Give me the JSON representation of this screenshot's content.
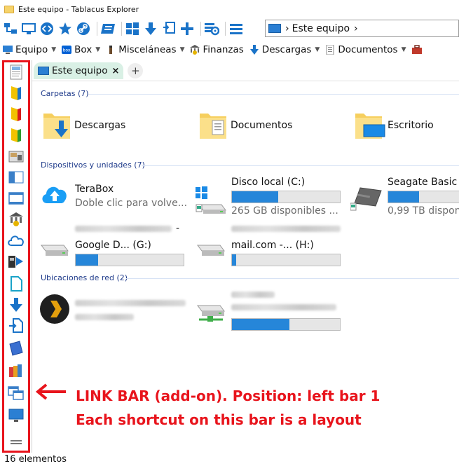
{
  "window": {
    "title": "Este equipo - Tablacus Explorer"
  },
  "address": {
    "separator": "›",
    "location": "Este equipo",
    "chevron": "›"
  },
  "favorites": [
    {
      "label": "Equipo",
      "icon": "monitor-icon"
    },
    {
      "label": "Box",
      "icon": "box-icon"
    },
    {
      "label": "Misceláneas",
      "icon": "pencil-icon"
    },
    {
      "label": "Finanzas",
      "icon": "bank-icon"
    },
    {
      "label": "Descargas",
      "icon": "download-arrow-icon"
    },
    {
      "label": "Documentos",
      "icon": "document-icon"
    }
  ],
  "tabs": [
    {
      "label": "Este equipo",
      "close": "×"
    }
  ],
  "new_tab": "+",
  "groups": {
    "folders": {
      "header": "Carpetas (7)",
      "items": [
        {
          "name": "Descargas",
          "icon": "downloads-folder-icon"
        },
        {
          "name": "Documentos",
          "icon": "documents-folder-icon"
        },
        {
          "name": "Escritorio",
          "icon": "desktop-folder-icon"
        }
      ]
    },
    "devices": {
      "header": "Dispositivos y unidades (7)",
      "items": [
        {
          "name": "TeraBox",
          "sub": "Doble clic para volve...",
          "icon": "terabox-cloud-icon",
          "usage": null
        },
        {
          "name": "Disco local (C:)",
          "sub": "265 GB disponibles ...",
          "icon": "windows-drive-icon",
          "usage": 0.43
        },
        {
          "name": "Seagate Basic (",
          "sub": "0,99 TB dispon",
          "icon": "external-drive-icon",
          "usage": 0.41
        },
        {
          "name": "Google D... (G:)",
          "prefix": "-",
          "icon": "network-drive-icon",
          "usage": 0.21
        },
        {
          "name": "mail.com -... (H:)",
          "icon": "network-drive-icon",
          "usage": 0.04
        }
      ]
    },
    "network": {
      "header": "Ubicaciones de red (2)",
      "items": [
        {
          "icon": "plex-icon",
          "usage": null
        },
        {
          "icon": "network-location-icon",
          "usage": 0.53
        }
      ]
    }
  },
  "annotation": {
    "line1": "LINK BAR (add-on). Position: left bar 1",
    "line2": "Each shortcut on this bar is a layout"
  },
  "status": {
    "text": "16 elementos"
  },
  "colors": {
    "accent": "#2686d9",
    "annotation": "#e8141c",
    "tab_bg": "#d9f0e5"
  }
}
